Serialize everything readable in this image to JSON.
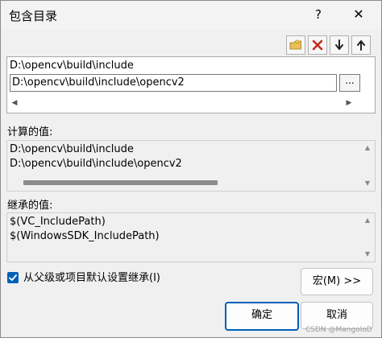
{
  "window": {
    "title": "包含目录",
    "help_glyph": "?",
    "close_glyph": "✕"
  },
  "toolbar": {
    "buttons": [
      {
        "icon": "new-folder-icon"
      },
      {
        "icon": "delete-x-icon"
      },
      {
        "icon": "move-down-icon"
      },
      {
        "icon": "move-up-icon"
      }
    ]
  },
  "dir_list": {
    "items": [
      "D:\\opencv\\build\\include"
    ],
    "edit_value": "D:\\opencv\\build\\include\\opencv2",
    "browse_label": "...",
    "scroll_left": "◀",
    "scroll_right": "▶"
  },
  "evaluated": {
    "label": "计算的值:",
    "lines": [
      "D:\\opencv\\build\\include",
      "D:\\opencv\\build\\include\\opencv2"
    ],
    "scroll_up": "▲",
    "scroll_down": "▼"
  },
  "inherited": {
    "label": "继承的值:",
    "lines": [
      "$(VC_IncludePath)",
      "$(WindowsSDK_IncludePath)"
    ],
    "scroll_up": "▲",
    "scroll_down": "▼"
  },
  "inherit_checkbox": {
    "label": "从父级或项目默认设置继承(I)",
    "checked": true
  },
  "buttons": {
    "macro": "宏(M) >>",
    "ok": "确定",
    "cancel": "取消"
  },
  "watermark": "CSDN @MangoloD",
  "colors": {
    "accent": "#005fb8",
    "delete_red": "#c42b1c"
  }
}
